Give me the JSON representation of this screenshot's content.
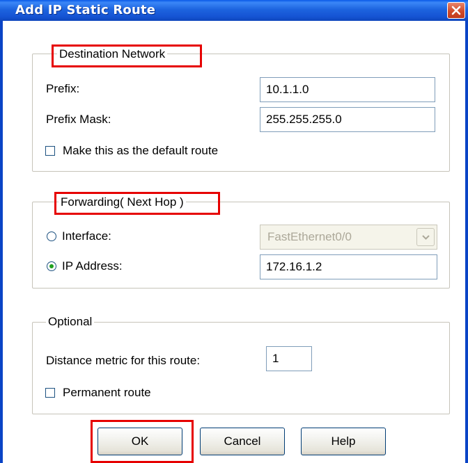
{
  "window": {
    "title": "Add IP Static Route"
  },
  "destination": {
    "legend": "Destination Network",
    "prefix_label": "Prefix:",
    "prefix_value": "10.1.1.0",
    "mask_label": "Prefix Mask:",
    "mask_value": "255.255.255.0",
    "default_route_label": "Make this as the default route",
    "default_route_checked": false
  },
  "forwarding": {
    "legend": "Forwarding( Next Hop )",
    "interface_label": "Interface:",
    "interface_value": "FastEthernet0/0",
    "interface_selected": false,
    "ip_label": "IP Address:",
    "ip_value": "172.16.1.2",
    "ip_selected": true
  },
  "optional": {
    "legend": "Optional",
    "distance_label": "Distance metric for this route:",
    "distance_value": "1",
    "permanent_label": "Permanent route",
    "permanent_checked": false
  },
  "buttons": {
    "ok": "OK",
    "cancel": "Cancel",
    "help": "Help"
  },
  "colors": {
    "highlight": "#e60000",
    "titlebar": "#1d64df"
  }
}
